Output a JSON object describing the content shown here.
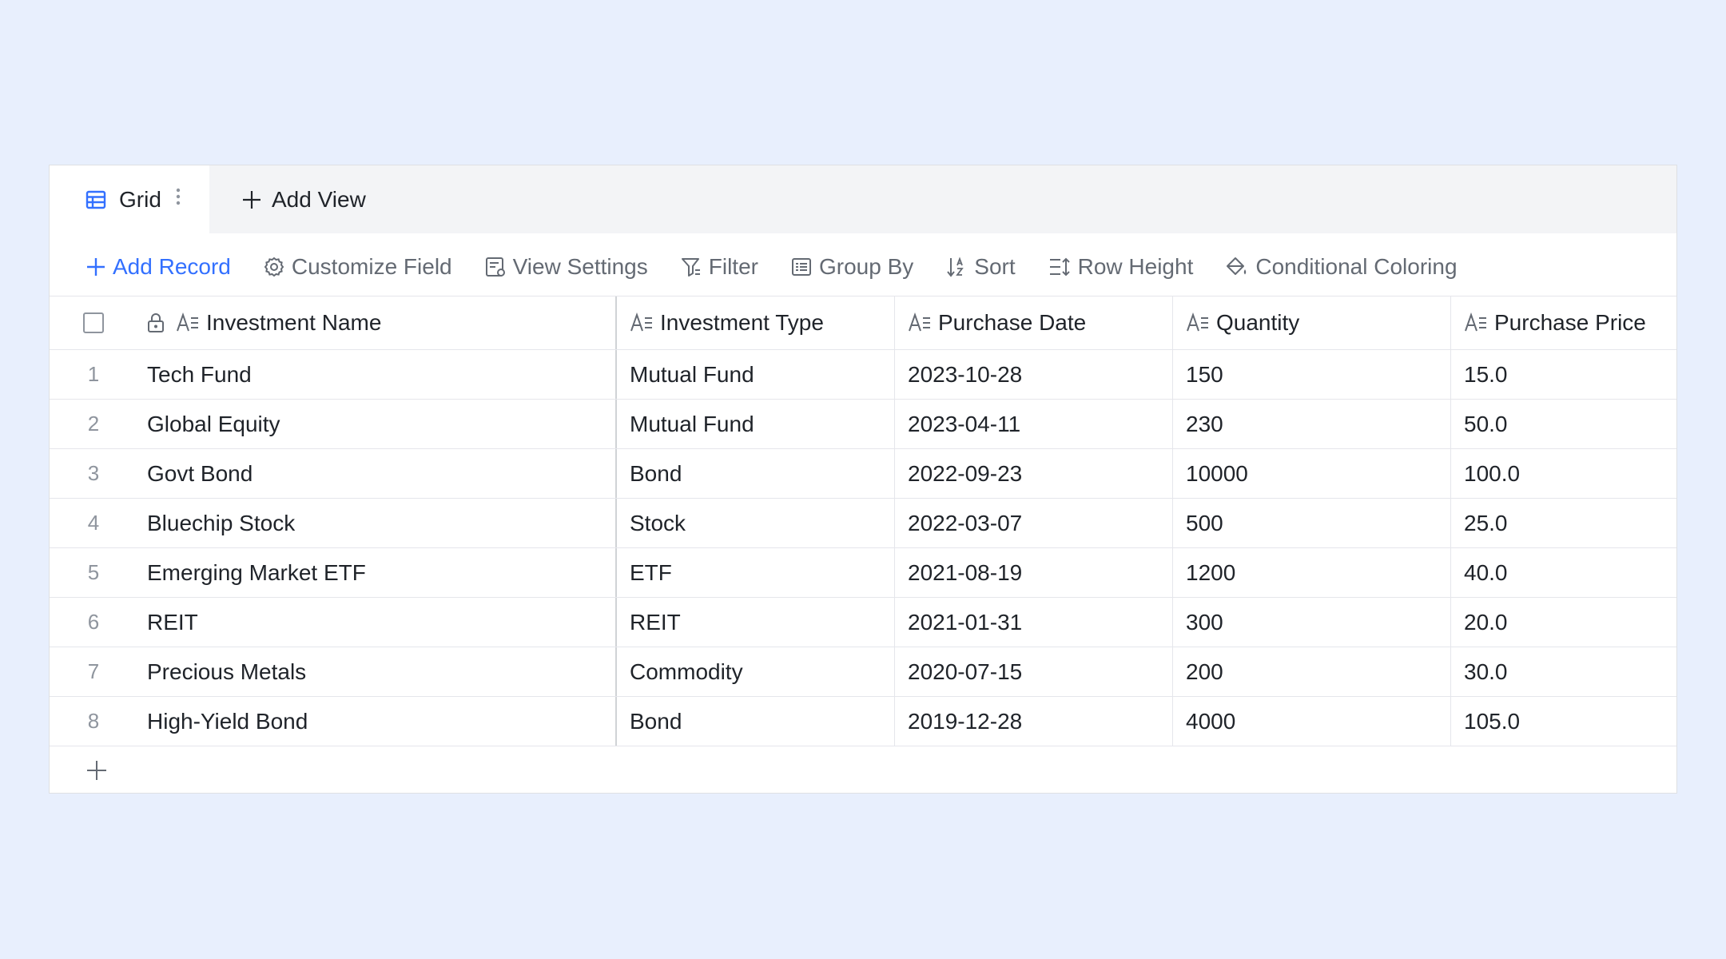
{
  "view_tabs": {
    "active_tab": "Grid",
    "add_view_label": "Add View"
  },
  "toolbar": {
    "add_record": "Add Record",
    "customize_field": "Customize Field",
    "view_settings": "View Settings",
    "filter": "Filter",
    "group_by": "Group By",
    "sort": "Sort",
    "row_height": "Row Height",
    "conditional_coloring": "Conditional Coloring"
  },
  "colors": {
    "accent": "#3370ff",
    "page_background": "#e8effd"
  },
  "table": {
    "columns": [
      "Investment Name",
      "Investment Type",
      "Purchase Date",
      "Quantity",
      "Purchase Price"
    ],
    "rows": [
      {
        "index": "1",
        "name": "Tech Fund",
        "type": "Mutual Fund",
        "date": "2023-10-28",
        "quantity": "150",
        "price": "15.0"
      },
      {
        "index": "2",
        "name": "Global Equity",
        "type": "Mutual Fund",
        "date": "2023-04-11",
        "quantity": "230",
        "price": "50.0"
      },
      {
        "index": "3",
        "name": "Govt Bond",
        "type": "Bond",
        "date": "2022-09-23",
        "quantity": "10000",
        "price": "100.0"
      },
      {
        "index": "4",
        "name": "Bluechip Stock",
        "type": "Stock",
        "date": "2022-03-07",
        "quantity": "500",
        "price": "25.0"
      },
      {
        "index": "5",
        "name": "Emerging Market ETF",
        "type": "ETF",
        "date": "2021-08-19",
        "quantity": "1200",
        "price": "40.0"
      },
      {
        "index": "6",
        "name": "REIT",
        "type": "REIT",
        "date": "2021-01-31",
        "quantity": "300",
        "price": "20.0"
      },
      {
        "index": "7",
        "name": "Precious Metals",
        "type": "Commodity",
        "date": "2020-07-15",
        "quantity": "200",
        "price": "30.0"
      },
      {
        "index": "8",
        "name": "High-Yield Bond",
        "type": "Bond",
        "date": "2019-12-28",
        "quantity": "4000",
        "price": "105.0"
      }
    ]
  }
}
